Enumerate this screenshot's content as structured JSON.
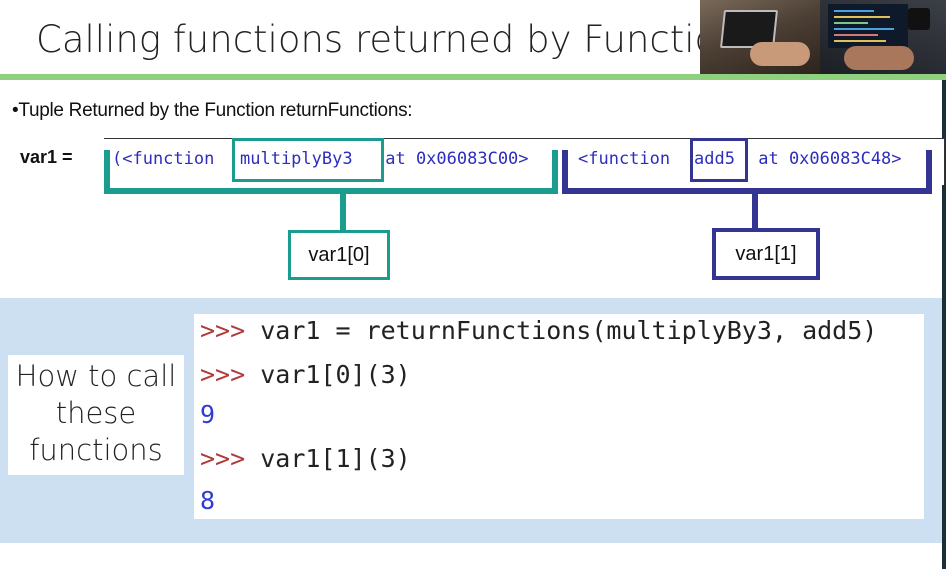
{
  "slide": {
    "title": "Calling functions returned by Functions",
    "bullet": "•Tuple Returned by the Function returnFunctions:",
    "var_label": "var1  ="
  },
  "tuple": {
    "open": "(<function ",
    "func1": "multiplyBy3",
    "addr1": " at 0x06083C00>",
    "sep": ", ",
    "open2": "<function ",
    "func2": "add5",
    "addr2": " at 0x06083C48>"
  },
  "annotations": {
    "left_label": "var1[0]",
    "right_label": "var1[1]"
  },
  "how_to": {
    "lines": [
      "How to call",
      "these",
      "functions"
    ]
  },
  "shell": {
    "prompt": ">>> ",
    "line1": "var1 = returnFunctions(multiplyBy3, add5)",
    "line2": "var1[0](3)",
    "out1": "9",
    "line3": "var1[1](3)",
    "out2": "8"
  },
  "colors": {
    "accent_green": "#8fd07f",
    "teal": "#1a9c8e",
    "navy": "#343593",
    "panel_blue": "#cde0f1",
    "prompt_red": "#b33a3a",
    "output_blue": "#2f3cd0"
  },
  "icons": [
    "laptop-photo",
    "coding-photo"
  ]
}
